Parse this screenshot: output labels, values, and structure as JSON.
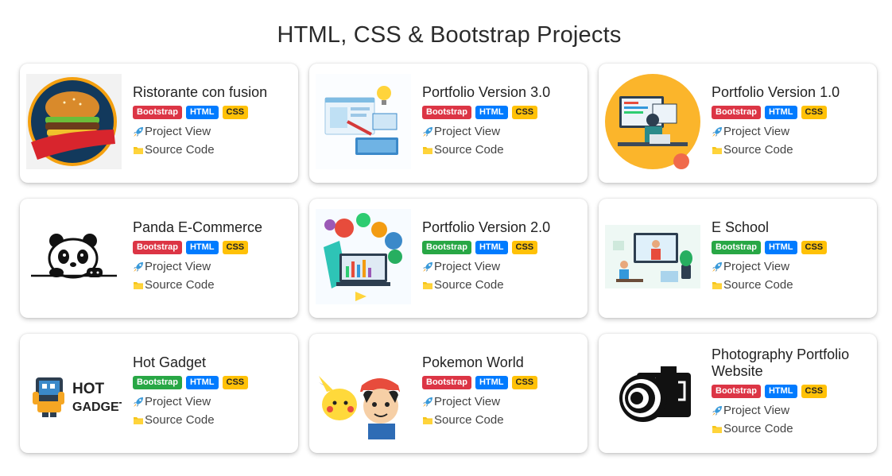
{
  "page_title": "HTML, CSS & Bootstrap Projects",
  "colors": {
    "bootstrap_red": "#dc3545",
    "bootstrap_green": "#28a745",
    "html_blue": "#007bff",
    "css_yellow": "#ffc107"
  },
  "projects": [
    {
      "title": "Ristorante con fusion",
      "image_icon": "burger-icon",
      "bootstrap_color": "red",
      "badges": {
        "bootstrap": "Bootstrap",
        "html": "HTML",
        "css": "CSS"
      },
      "links": {
        "view": "Project View",
        "source": "Source Code"
      }
    },
    {
      "title": "Portfolio Version 3.0",
      "image_icon": "web-design-illustration-icon",
      "bootstrap_color": "red",
      "badges": {
        "bootstrap": "Bootstrap",
        "html": "HTML",
        "css": "CSS"
      },
      "links": {
        "view": "Project View",
        "source": "Source Code"
      }
    },
    {
      "title": "Portfolio Version 1.0",
      "image_icon": "developer-desk-illustration-icon",
      "bootstrap_color": "red",
      "badges": {
        "bootstrap": "Bootstrap",
        "html": "HTML",
        "css": "CSS"
      },
      "links": {
        "view": "Project View",
        "source": "Source Code"
      }
    },
    {
      "title": "Panda E-Commerce",
      "image_icon": "panda-icon",
      "bootstrap_color": "red",
      "badges": {
        "bootstrap": "Bootstrap",
        "html": "HTML",
        "css": "CSS"
      },
      "links": {
        "view": "Project View",
        "source": "Source Code"
      }
    },
    {
      "title": "Portfolio Version 2.0",
      "image_icon": "programming-languages-illustration-icon",
      "bootstrap_color": "green",
      "badges": {
        "bootstrap": "Bootstrap",
        "html": "HTML",
        "css": "CSS"
      },
      "links": {
        "view": "Project View",
        "source": "Source Code"
      }
    },
    {
      "title": "E School",
      "image_icon": "online-classroom-illustration-icon",
      "bootstrap_color": "green",
      "badges": {
        "bootstrap": "Bootstrap",
        "html": "HTML",
        "css": "CSS"
      },
      "links": {
        "view": "Project View",
        "source": "Source Code"
      }
    },
    {
      "title": "Hot Gadget",
      "image_icon": "hot-gadgets-logo-icon",
      "bootstrap_color": "green",
      "logo_text": "HOT GADGETS",
      "badges": {
        "bootstrap": "Bootstrap",
        "html": "HTML",
        "css": "CSS"
      },
      "links": {
        "view": "Project View",
        "source": "Source Code"
      }
    },
    {
      "title": "Pokemon World",
      "image_icon": "pokemon-illustration-icon",
      "bootstrap_color": "red",
      "badges": {
        "bootstrap": "Bootstrap",
        "html": "HTML",
        "css": "CSS"
      },
      "links": {
        "view": "Project View",
        "source": "Source Code"
      }
    },
    {
      "title": "Photography Portfolio Website",
      "image_icon": "camera-icon",
      "bootstrap_color": "red",
      "badges": {
        "bootstrap": "Bootstrap",
        "html": "HTML",
        "css": "CSS"
      },
      "links": {
        "view": "Project View",
        "source": "Source Code"
      }
    }
  ]
}
